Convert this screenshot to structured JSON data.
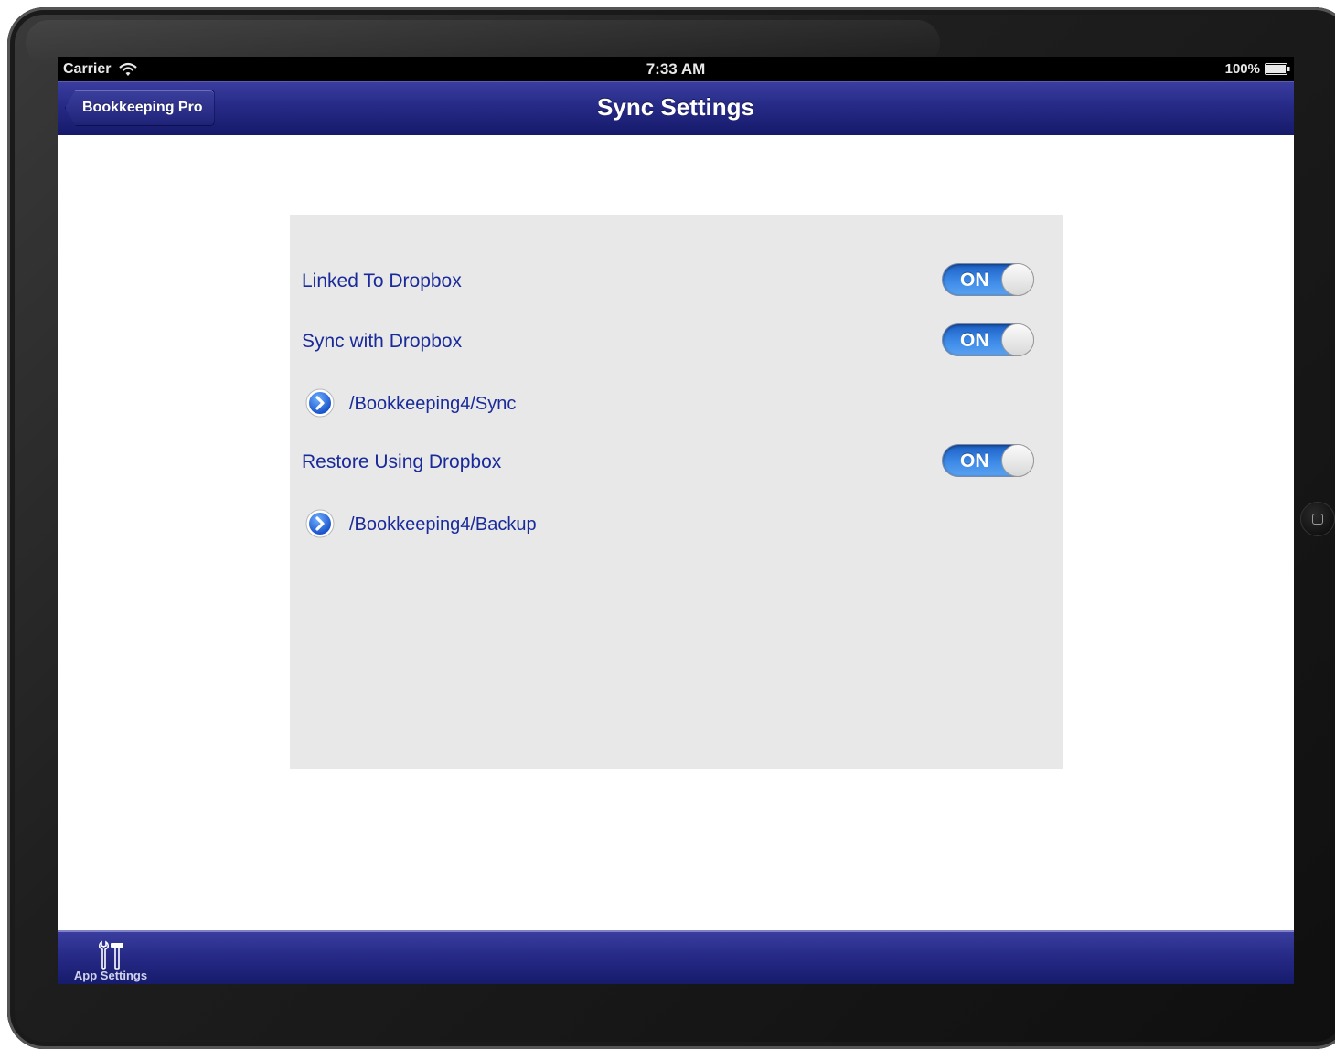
{
  "status_bar": {
    "carrier": "Carrier",
    "time": "7:33 AM",
    "battery": "100%"
  },
  "nav": {
    "back_label": "Bookkeeping Pro",
    "title": "Sync Settings"
  },
  "settings": {
    "linked": {
      "label": "Linked To Dropbox",
      "state": "ON"
    },
    "sync": {
      "label": "Sync with Dropbox",
      "state": "ON"
    },
    "sync_path": "/Bookkeeping4/Sync",
    "restore": {
      "label": "Restore Using Dropbox",
      "state": "ON"
    },
    "backup_path": "/Bookkeeping4/Backup"
  },
  "tab_bar": {
    "items": [
      {
        "label": "App Settings",
        "icon": "tools-icon"
      }
    ]
  },
  "colors": {
    "nav_blue": "#262a86",
    "label_blue": "#1a2a9a",
    "toggle_on": "#3d8ae8",
    "panel_gray": "#e8e8e8"
  }
}
